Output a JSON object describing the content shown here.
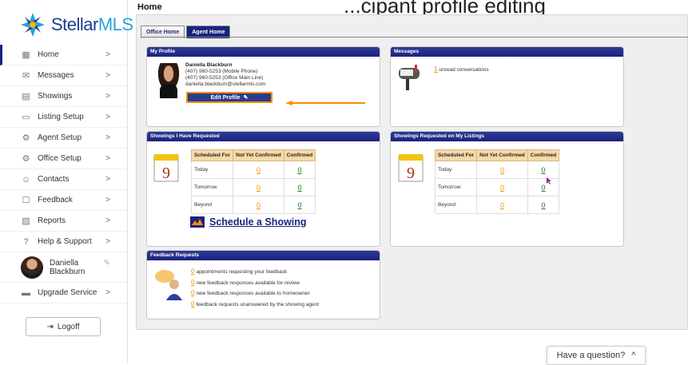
{
  "banner": {
    "text": "...cipant profile editing"
  },
  "sidebar": {
    "logo_text_a": "Stellar",
    "logo_text_b": "MLS",
    "items": [
      {
        "label": "Home",
        "icon": "home-icon",
        "glyph": "▦",
        "chev": ">"
      },
      {
        "label": "Messages",
        "icon": "envelope-icon",
        "glyph": "✉",
        "chev": ">"
      },
      {
        "label": "Showings",
        "icon": "calendar-icon",
        "glyph": "▤",
        "chev": ">"
      },
      {
        "label": "Listing Setup",
        "icon": "listing-icon",
        "glyph": "▭",
        "chev": ">"
      },
      {
        "label": "Agent Setup",
        "icon": "agent-setup-icon",
        "glyph": "⚙",
        "chev": ">"
      },
      {
        "label": "Office Setup",
        "icon": "office-setup-icon",
        "glyph": "⚙",
        "chev": ">"
      },
      {
        "label": "Contacts",
        "icon": "contacts-icon",
        "glyph": "☺",
        "chev": ">"
      },
      {
        "label": "Feedback",
        "icon": "feedback-icon",
        "glyph": "☐",
        "chev": ">"
      },
      {
        "label": "Reports",
        "icon": "reports-icon",
        "glyph": "▨",
        "chev": ">"
      },
      {
        "label": "Help & Support",
        "icon": "help-icon",
        "glyph": "?",
        "chev": ">"
      }
    ],
    "profile": {
      "first": "Daniella",
      "last": "Blackburn"
    },
    "upgrade": {
      "label": "Upgrade Service",
      "chev": ">"
    },
    "logoff": {
      "label": "Logoff",
      "glyph": "⇥"
    }
  },
  "page": {
    "title": "Home",
    "tabs": [
      "Office Home",
      "Agent Home"
    ],
    "active_tab": "Agent Home"
  },
  "my_profile": {
    "heading": "My Profile",
    "name": "Daniella Blackburn",
    "mobile": "(407) 960-5253 (Mobile Phone)",
    "office": "(407) 960-5253 (Office Main Line)",
    "email": "daniella.blackburn@stellarmls.com",
    "edit_label": "Edit Profile"
  },
  "messages": {
    "heading": "Messages",
    "count": "1",
    "text": "unread conversations"
  },
  "showings_requested": {
    "heading": "Showings I Have Requested",
    "columns": [
      "Scheduled For",
      "Not Yet Confirmed",
      "Confirmed"
    ],
    "rows": [
      {
        "label": "Today",
        "not_confirmed": "0",
        "confirmed": "0"
      },
      {
        "label": "Tomorrow",
        "not_confirmed": "0",
        "confirmed": "0"
      },
      {
        "label": "Beyond",
        "not_confirmed": "0",
        "confirmed": "0"
      }
    ],
    "schedule_link": "Schedule a Showing"
  },
  "showings_listings": {
    "heading": "Showings Requested on My Listings",
    "columns": [
      "Scheduled For",
      "Not Yet Confirmed",
      "Confirmed"
    ],
    "rows": [
      {
        "label": "Today",
        "not_confirmed": "0",
        "confirmed": "0"
      },
      {
        "label": "Tomorrow",
        "not_confirmed": "0",
        "confirmed": "0"
      },
      {
        "label": "Beyond",
        "not_confirmed": "0",
        "confirmed": "0"
      }
    ]
  },
  "feedback": {
    "heading": "Feedback Requests",
    "items": [
      {
        "count": "0",
        "text": "appointments requesting your feedback"
      },
      {
        "count": "0",
        "text": "new feedback responses available for review"
      },
      {
        "count": "0",
        "text": "new feedback responses available to homeowner"
      },
      {
        "count": "0",
        "text": "feedback requests unanswered by the showing agent"
      }
    ]
  },
  "help": {
    "label": "Have a question?",
    "chev": "^"
  },
  "colors": {
    "navy": "#1a237e",
    "orange": "#f39200",
    "green": "#1a7a1a"
  }
}
